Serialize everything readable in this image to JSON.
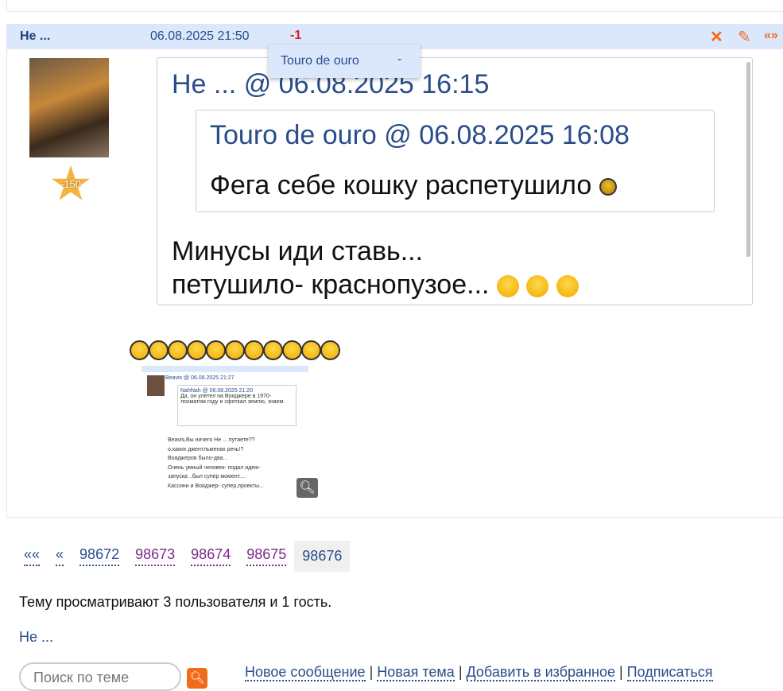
{
  "post": {
    "author": "Не ...",
    "date": "06.08.2025 21:50",
    "rating": "-1",
    "actions": {
      "delete": "✕",
      "edit": "✎",
      "quote": "«»"
    },
    "rating_popup": {
      "user": "Touro de ouro",
      "value": "-"
    },
    "author_rank": "-150",
    "quote": {
      "header": "Не ... @ 06.08.2025 16:15",
      "inner": {
        "header": "Touro de ouro @ 06.08.2025 16:08",
        "text": "Фега себе кошку распетушило"
      },
      "lines": [
        "Минусы иди ставь...",
        "петушило- краснопузое..."
      ]
    },
    "emoji_count": 11,
    "thumbnail": {
      "q1": "Beavis @ 06.08.2025 21:27",
      "q2": "NahNah @ 06.08.2025 21:20",
      "q2text": "Да, он улетел на Вояджере в 1970-лохматом году и сфоткал землю, знаем.",
      "lines": [
        "Beavis,Вы ничего Не ... путаете??",
        "о,каких джентльменах речь!?",
        "Вояджеров было-два...",
        "Очень умный человек- подал идею-",
        "запуска ..был супер момент....",
        "Кассини и Вояджер- супер,проекты..."
      ]
    }
  },
  "pagination": {
    "first": "««",
    "prev": "«",
    "pages": [
      "98672",
      "98673",
      "98674",
      "98675"
    ],
    "current": "98676"
  },
  "viewers_text": "Тему просматривают 3 пользователя и 1 гость.",
  "viewer_user": "Не ...",
  "search": {
    "placeholder": "Поиск по теме"
  },
  "links": [
    "Новое сообщение",
    "Новая тема",
    "Добавить в избранное",
    "Подписаться"
  ]
}
